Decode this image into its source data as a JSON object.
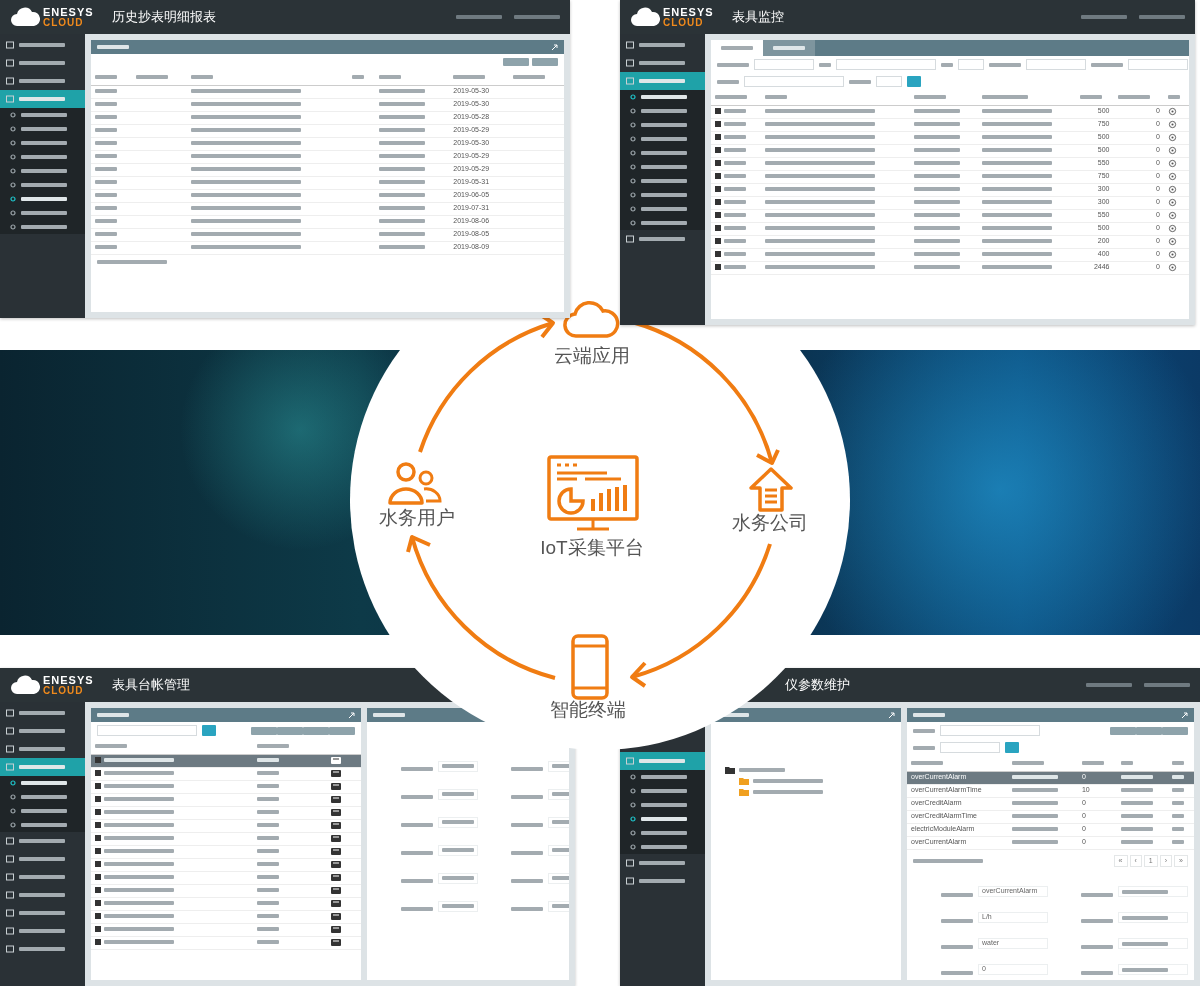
{
  "screens": [
    {
      "kind": "report",
      "brand": "ENESYS",
      "brand_sub": "CLOUD",
      "title": "历史抄表明细报表",
      "sidebar": [
        {
          "kind": "group",
          "selected": false
        },
        {
          "kind": "group",
          "selected": false
        },
        {
          "kind": "group",
          "selected": false
        },
        {
          "kind": "group",
          "selected": true
        },
        {
          "kind": "sub",
          "selected": false
        },
        {
          "kind": "sub",
          "selected": false
        },
        {
          "kind": "sub",
          "selected": false
        },
        {
          "kind": "sub",
          "selected": false
        },
        {
          "kind": "sub",
          "selected": false
        },
        {
          "kind": "sub",
          "selected": false
        },
        {
          "kind": "sub",
          "selected": true
        },
        {
          "kind": "sub",
          "selected": false
        },
        {
          "kind": "sub",
          "selected": false
        }
      ],
      "rows": [
        {
          "date": "2019-05-30"
        },
        {
          "date": "2019-05-30"
        },
        {
          "date": "2019-05-28"
        },
        {
          "date": "2019-05-29"
        },
        {
          "date": "2019-05-30"
        },
        {
          "date": "2019-05-29"
        },
        {
          "date": "2019-05-29"
        },
        {
          "date": "2019-05-31"
        },
        {
          "date": "2019-06-05"
        },
        {
          "date": "2019-07-31"
        },
        {
          "date": "2019-08-06"
        },
        {
          "date": "2019-08-05"
        },
        {
          "date": "2019-08-09"
        }
      ]
    },
    {
      "kind": "monitor",
      "brand": "ENESYS",
      "brand_sub": "CLOUD",
      "title": "表具监控",
      "sidebar": [
        {
          "kind": "group",
          "selected": false
        },
        {
          "kind": "group",
          "selected": false
        },
        {
          "kind": "group",
          "selected": true
        },
        {
          "kind": "sub",
          "selected": true
        },
        {
          "kind": "sub",
          "selected": false
        },
        {
          "kind": "sub",
          "selected": false
        },
        {
          "kind": "sub",
          "selected": false
        },
        {
          "kind": "sub",
          "selected": false
        },
        {
          "kind": "sub",
          "selected": false
        },
        {
          "kind": "sub",
          "selected": false
        },
        {
          "kind": "sub",
          "selected": false
        },
        {
          "kind": "sub",
          "selected": false
        },
        {
          "kind": "sub",
          "selected": false
        },
        {
          "kind": "group",
          "selected": false
        }
      ],
      "tabs": [
        {
          "selected": true
        },
        {
          "selected": false
        }
      ],
      "rows": [
        {
          "reading": "500",
          "count": "0"
        },
        {
          "reading": "750",
          "count": "0"
        },
        {
          "reading": "500",
          "count": "0"
        },
        {
          "reading": "500",
          "count": "0"
        },
        {
          "reading": "550",
          "count": "0"
        },
        {
          "reading": "750",
          "count": "0"
        },
        {
          "reading": "300",
          "count": "0"
        },
        {
          "reading": "300",
          "count": "0"
        },
        {
          "reading": "550",
          "count": "0"
        },
        {
          "reading": "500",
          "count": "0"
        },
        {
          "reading": "200",
          "count": "0"
        },
        {
          "reading": "400",
          "count": "0"
        },
        {
          "reading": "2446",
          "count": "0"
        }
      ]
    },
    {
      "kind": "ledger",
      "brand": "ENESYS",
      "brand_sub": "CLOUD",
      "title": "表具台帐管理",
      "sidebar": [
        {
          "kind": "group",
          "selected": false
        },
        {
          "kind": "group",
          "selected": false
        },
        {
          "kind": "group",
          "selected": false
        },
        {
          "kind": "group",
          "selected": true
        },
        {
          "kind": "sub",
          "selected": true
        },
        {
          "kind": "sub",
          "selected": false
        },
        {
          "kind": "sub",
          "selected": false
        },
        {
          "kind": "sub",
          "selected": false
        },
        {
          "kind": "group",
          "selected": false
        },
        {
          "kind": "group",
          "selected": false
        },
        {
          "kind": "group",
          "selected": false
        },
        {
          "kind": "group",
          "selected": false
        },
        {
          "kind": "group",
          "selected": false
        },
        {
          "kind": "group",
          "selected": false
        },
        {
          "kind": "group",
          "selected": false
        }
      ],
      "rows": [
        {
          "selected": true
        },
        {
          "selected": false
        },
        {
          "selected": false
        },
        {
          "selected": false
        },
        {
          "selected": false
        },
        {
          "selected": false
        },
        {
          "selected": false
        },
        {
          "selected": false
        },
        {
          "selected": false
        },
        {
          "selected": false
        },
        {
          "selected": false
        },
        {
          "selected": false
        },
        {
          "selected": false
        },
        {
          "selected": false
        },
        {
          "selected": false
        }
      ]
    },
    {
      "kind": "params",
      "title": "仪参数维护",
      "sidebar": [
        {
          "kind": "group",
          "selected": true
        },
        {
          "kind": "sub",
          "selected": false
        },
        {
          "kind": "sub",
          "selected": false
        },
        {
          "kind": "sub",
          "selected": false
        },
        {
          "kind": "sub",
          "selected": true
        },
        {
          "kind": "sub",
          "selected": false
        },
        {
          "kind": "sub",
          "selected": false
        },
        {
          "kind": "group",
          "selected": false
        },
        {
          "kind": "group",
          "selected": false
        }
      ],
      "rows": [
        {
          "name": "overCurrentAlarm",
          "value": "0",
          "selected": true
        },
        {
          "name": "overCurrentAlarmTime",
          "value": "10",
          "selected": false
        },
        {
          "name": "overCreditAlarm",
          "value": "0",
          "selected": false
        },
        {
          "name": "overCreditAlarmTime",
          "value": "0",
          "selected": false
        },
        {
          "name": "electricModuleAlarm",
          "value": "0",
          "selected": false
        },
        {
          "name": "overCurrentAlarm",
          "value": "0",
          "selected": false
        }
      ],
      "pager": [
        "«",
        "‹",
        "1",
        "›",
        "»"
      ],
      "form": [
        "overCurrentAlarm",
        "L/h",
        "water",
        "0"
      ]
    }
  ],
  "diagram": {
    "center": "IoT采集平台",
    "nodes": [
      {
        "kind": "cloud",
        "label": "云端应用"
      },
      {
        "kind": "company",
        "label": "水务公司"
      },
      {
        "kind": "phone",
        "label": "智能终端"
      },
      {
        "kind": "users",
        "label": "水务用户"
      }
    ]
  }
}
